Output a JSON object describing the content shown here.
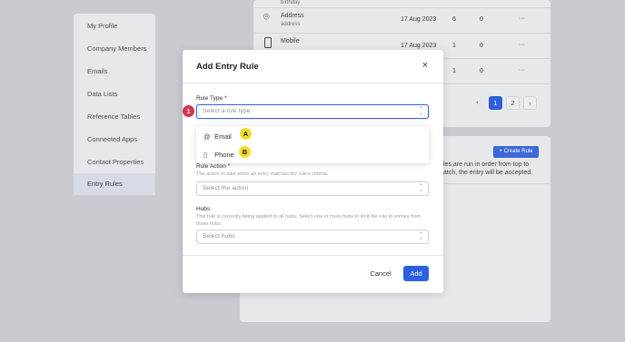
{
  "sidebar": {
    "items": [
      {
        "label": "My Profile"
      },
      {
        "label": "Company Members"
      },
      {
        "label": "Emails"
      },
      {
        "label": "Data Lists"
      },
      {
        "label": "Reference Tables"
      },
      {
        "label": "Connected Apps"
      },
      {
        "label": "Contact Properties"
      },
      {
        "label": "Entry Rules"
      }
    ]
  },
  "background_table": {
    "top_partial_sub": "birthday",
    "rows": [
      {
        "name": "Address",
        "sub": "address",
        "date": "17 Aug 2023",
        "count1": "6",
        "count2": "0",
        "menu": "···"
      },
      {
        "name": "Mobile",
        "sub": "",
        "date": "17 Aug 2023",
        "count1": "1",
        "count2": "0",
        "menu": "···"
      },
      {
        "name": "",
        "sub": "",
        "date": "",
        "count1": "1",
        "count2": "0",
        "menu": "···"
      }
    ],
    "pagination": {
      "prev": "‹",
      "pages": [
        "1",
        "2"
      ],
      "next": "›"
    }
  },
  "background_rules": {
    "create_button": "+ Create Rule",
    "text_line1": "les are run in order from top to",
    "text_line2": "atch, the entry will be accepted."
  },
  "modal": {
    "title": "Add Entry Rule",
    "close": "×",
    "rule_type": {
      "label": "Rule Type *",
      "placeholder": "Select a rule type",
      "options": [
        {
          "icon": "@",
          "label": "Email"
        },
        {
          "icon": "▯",
          "label": "Phone"
        }
      ]
    },
    "rule_action": {
      "label": "Rule Action *",
      "description": "The action to take when an entry matches the rule's criteria.",
      "placeholder": "Select the action"
    },
    "hubs": {
      "label": "Hubs",
      "description": "This rule is currently being applied to all hubs. Select one or more hubs to limit the rule to entries from those hubs.",
      "placeholder": "Select hubs"
    },
    "footer": {
      "cancel": "Cancel",
      "add": "Add"
    }
  },
  "annotations": {
    "step": "1",
    "email_badge": "A",
    "phone_badge": "B"
  },
  "colors": {
    "accent": "#2e5fe0",
    "step_badge": "#d6344a",
    "letter_badge": "#f3dc2e",
    "backdrop": "#c9cbd1"
  }
}
